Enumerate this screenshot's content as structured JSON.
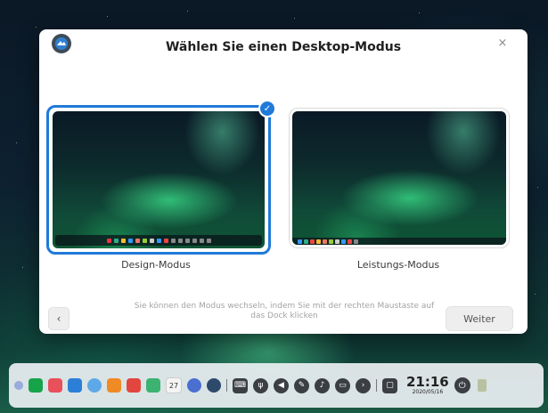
{
  "dialog": {
    "title": "Wählen Sie einen Desktop-Modus",
    "close_glyph": "×",
    "design_mode_label": "Design-Modus",
    "performance_mode_label": "Leistungs-Modus",
    "hint_line1": "Sie können den Modus wechseln, indem Sie mit der rechten Maustaste auf",
    "hint_line2": "das Dock klicken",
    "prev_glyph": "‹",
    "next_label": "Weiter",
    "selected_mode": "Design-Modus",
    "accent_color": "#1f7ad8"
  },
  "dock": {
    "calendar_day": "27",
    "time": "21:16",
    "date": "2020/05/16",
    "app_icons": [
      "launcher-icon",
      "terminal-icon",
      "mail-icon",
      "file-manager-icon",
      "browser-icon",
      "app-store-icon",
      "photos-icon",
      "music-icon",
      "calendar-icon",
      "settings-icon",
      "deepin-store-icon"
    ],
    "tray_icons": [
      "keyboard-icon",
      "usb-icon",
      "volume-icon",
      "pen-icon",
      "notification-icon",
      "battery-icon",
      "arrow-icon",
      "window-icon"
    ]
  }
}
